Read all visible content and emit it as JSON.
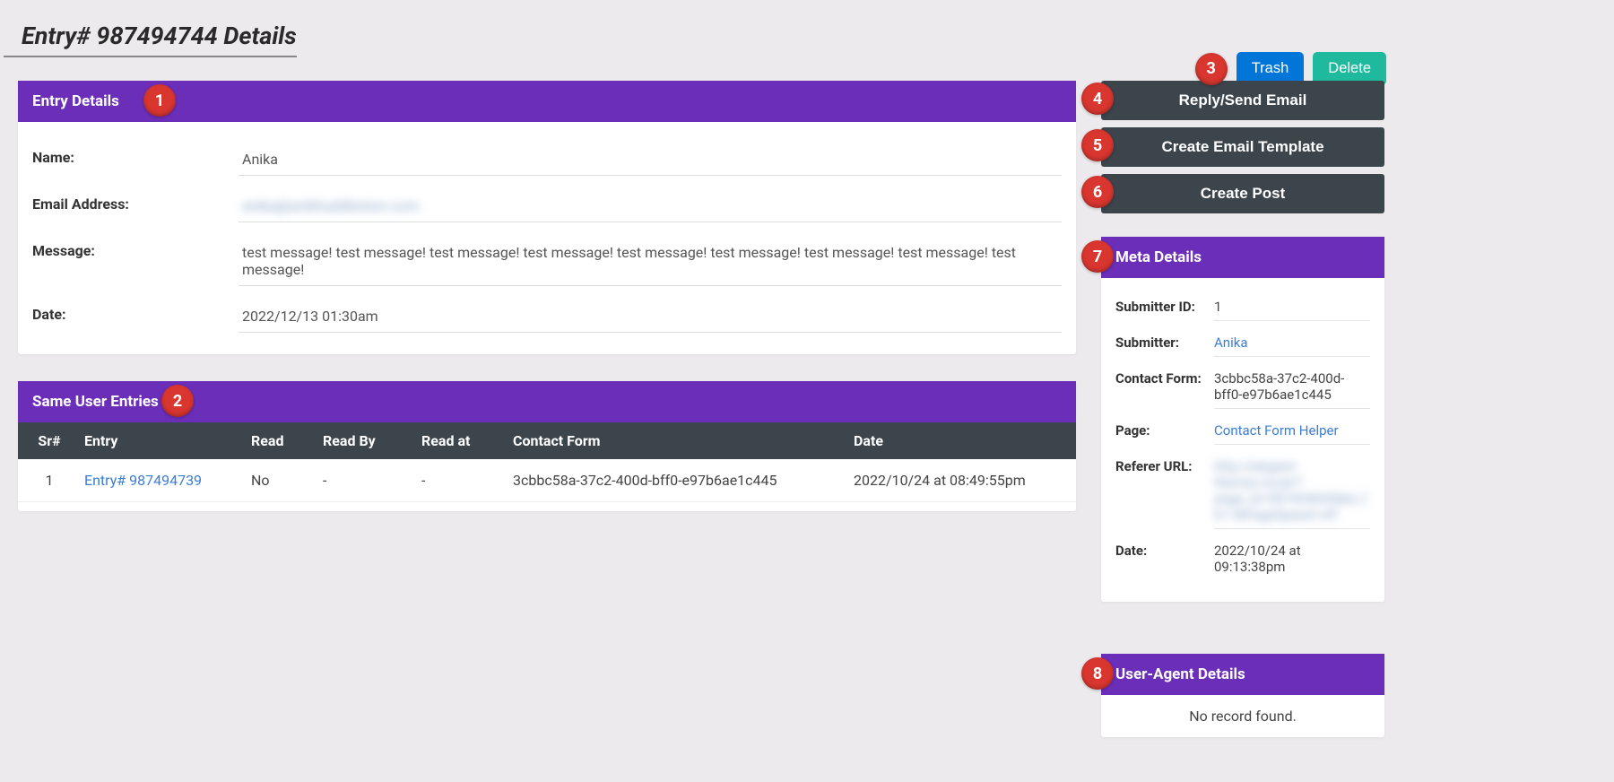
{
  "page": {
    "title": "Entry# 987494744 Details"
  },
  "topActions": {
    "trash": "Trash",
    "delete": "Delete"
  },
  "badges": {
    "entryDetails": "1",
    "sameUser": "2",
    "topActions": "3",
    "reply": "4",
    "template": "5",
    "createPost": "6",
    "meta": "7",
    "userAgent": "8"
  },
  "entryDetails": {
    "header": "Entry Details",
    "fields": {
      "nameLabel": "Name:",
      "nameValue": "Anika",
      "emailLabel": "Email Address:",
      "emailValue": "anika@anikhuddleston.com",
      "messageLabel": "Message:",
      "messageValue": "test message! test message! test message! test message! test message! test message! test message! test message! test message!",
      "dateLabel": "Date:",
      "dateValue": "2022/12/13 01:30am"
    }
  },
  "sameUser": {
    "header": "Same User Entries",
    "columns": {
      "sr": "Sr#",
      "entry": "Entry",
      "read": "Read",
      "readBy": "Read By",
      "readAt": "Read at",
      "form": "Contact Form",
      "date": "Date"
    },
    "rows": [
      {
        "sr": "1",
        "entry": "Entry# 987494739",
        "read": "No",
        "readBy": "-",
        "readAt": "-",
        "form": "3cbbc58a-37c2-400d-bff0-e97b6ae1c445",
        "date": "2022/10/24 at 08:49:55pm"
      }
    ]
  },
  "actions": {
    "reply": "Reply/Send Email",
    "template": "Create Email Template",
    "createPost": "Create Post"
  },
  "metaDetails": {
    "header": "Meta Details",
    "submitterIdLabel": "Submitter ID:",
    "submitterIdValue": "1",
    "submitterLabel": "Submitter:",
    "submitterValue": "Anika",
    "contactFormLabel": "Contact Form:",
    "contactFormValue": "3cbbc58a-37c2-400d-bff0-e97b6ae1c445",
    "pageLabel": "Page:",
    "pageValue": "Contact Form Helper",
    "refererLabel": "Referer URL:",
    "refererValue": "http://elegant-themes.local/?page_id=987494830&et_fb=1&PageSpeed=off",
    "dateLabel": "Date:",
    "dateValue": "2022/10/24 at 09:13:38pm"
  },
  "userAgent": {
    "header": "User-Agent Details",
    "noRecord": "No record found."
  }
}
